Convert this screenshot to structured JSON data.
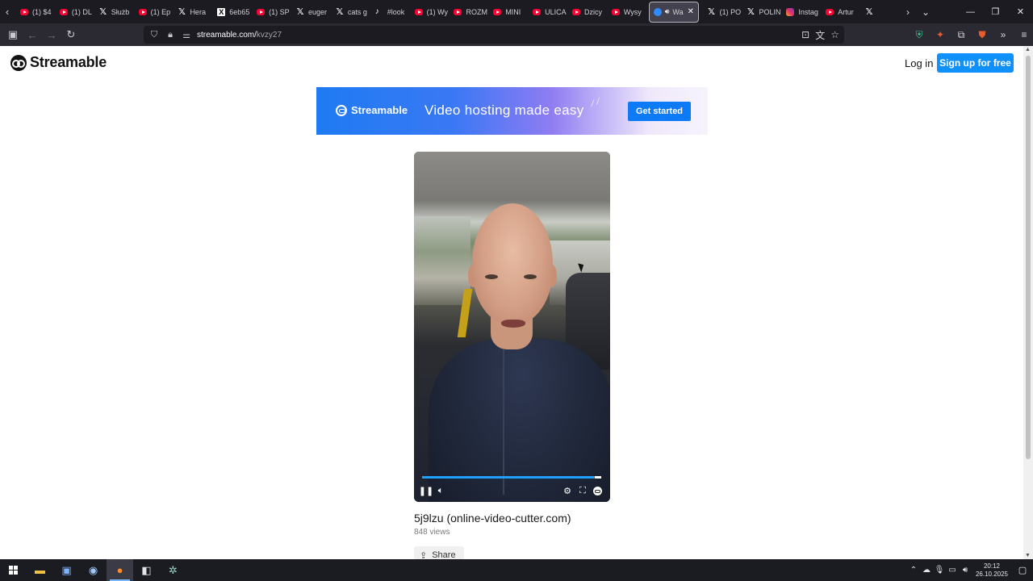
{
  "browser": {
    "tabs": [
      {
        "icon": "youtube-icon",
        "title": "(1) $4"
      },
      {
        "icon": "youtube-icon",
        "title": "(1) DL"
      },
      {
        "icon": "x-icon",
        "title": "Służb"
      },
      {
        "icon": "youtube-icon",
        "title": "(1) Ep"
      },
      {
        "icon": "x-icon",
        "title": "Hera"
      },
      {
        "icon": "xbox-icon",
        "title": "6eb65"
      },
      {
        "icon": "youtube-icon",
        "title": "(1) SP"
      },
      {
        "icon": "x-icon",
        "title": "euger"
      },
      {
        "icon": "x-icon",
        "title": "cats g"
      },
      {
        "icon": "tiktok-icon",
        "title": "#look"
      },
      {
        "icon": "youtube-icon",
        "title": "(1) Wy"
      },
      {
        "icon": "youtube-icon",
        "title": "ROZM"
      },
      {
        "icon": "youtube-icon",
        "title": "MINI"
      },
      {
        "icon": "youtube-icon",
        "title": "ULICA"
      },
      {
        "icon": "youtube-icon",
        "title": "Dzicy"
      },
      {
        "icon": "youtube-icon",
        "title": "Wysy"
      },
      {
        "icon": "streamable-icon",
        "title": "Wa",
        "active": true
      },
      {
        "icon": "x-icon",
        "title": "(1) PO"
      },
      {
        "icon": "x-icon",
        "title": "POLIN"
      },
      {
        "icon": "instagram-icon",
        "title": "Instag"
      },
      {
        "icon": "youtube-icon",
        "title": "Artur"
      },
      {
        "icon": "x-icon",
        "title": ""
      }
    ],
    "url_host": "streamable.com/",
    "url_path": "kvzy27"
  },
  "site": {
    "logo_text": "Streamable",
    "login_label": "Log in",
    "signup_label": "Sign up for free"
  },
  "banner": {
    "brand": "Streamable",
    "tagline": "Video hosting made easy",
    "cta": "Get started"
  },
  "video": {
    "progress_fraction": 0.96,
    "title": "5j9lzu (online-video-cutter.com)",
    "views": "848 views",
    "share_label": "Share"
  },
  "taskbar": {
    "time": "20:12",
    "date": "26.10.2025"
  }
}
